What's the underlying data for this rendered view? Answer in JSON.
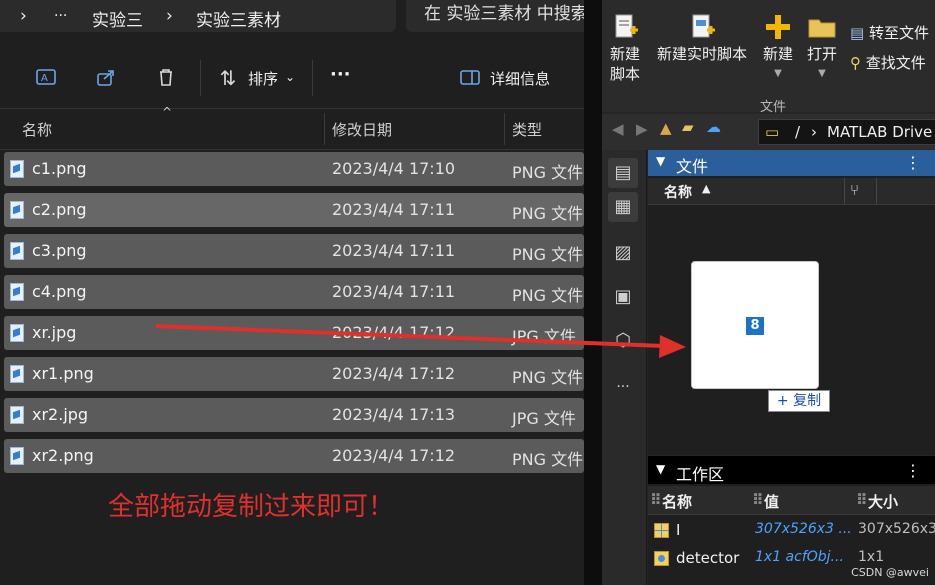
{
  "explorer": {
    "breadcrumb": [
      "实验三",
      "实验三素材"
    ],
    "breadcrumb_more": "···",
    "search_placeholder": "在 实验三素材 中搜索",
    "toolbar": {
      "sort_label": "排序",
      "more_label": "···",
      "details_label": "详细信息"
    },
    "columns": {
      "name": "名称",
      "date": "修改日期",
      "type": "类型"
    },
    "files": [
      {
        "name": "c1.png",
        "date": "2023/4/4 17:10",
        "type": "PNG 文件"
      },
      {
        "name": "c2.png",
        "date": "2023/4/4 17:11",
        "type": "PNG 文件"
      },
      {
        "name": "c3.png",
        "date": "2023/4/4 17:11",
        "type": "PNG 文件"
      },
      {
        "name": "c4.png",
        "date": "2023/4/4 17:11",
        "type": "PNG 文件"
      },
      {
        "name": "xr.jpg",
        "date": "2023/4/4 17:12",
        "type": "JPG 文件"
      },
      {
        "name": "xr1.png",
        "date": "2023/4/4 17:12",
        "type": "PNG 文件"
      },
      {
        "name": "xr2.jpg",
        "date": "2023/4/4 17:13",
        "type": "JPG 文件"
      },
      {
        "name": "xr2.png",
        "date": "2023/4/4 17:12",
        "type": "PNG 文件"
      }
    ],
    "note": "全部拖动复制过来即可！"
  },
  "matlab": {
    "ribbon": {
      "new_script": "新建\n脚本",
      "new_live_script": "新建实时脚本",
      "new": "新建",
      "open": "打开",
      "goto_file": "转至文件",
      "find_file": "查找文件",
      "group_label": "文件"
    },
    "path": {
      "root": "/",
      "drive": "MATLAB Drive"
    },
    "file_panel": {
      "title": "文件",
      "name_col": "名称",
      "drag_count": "8",
      "copy_label": "+ 复制"
    },
    "workspace": {
      "title": "工作区",
      "columns": {
        "name": "名称",
        "value": "值",
        "size": "大小"
      },
      "rows": [
        {
          "name": "I",
          "value": "307x526x3 ...",
          "size": "307x526x3"
        },
        {
          "name": "detector",
          "value": "1x1 acfObj...",
          "size": "1x1"
        }
      ]
    },
    "watermark": "CSDN @awvei"
  },
  "colors": {
    "accent": "#2a5f9c",
    "annotation": "#e0302b",
    "link": "#4aa3ff"
  }
}
